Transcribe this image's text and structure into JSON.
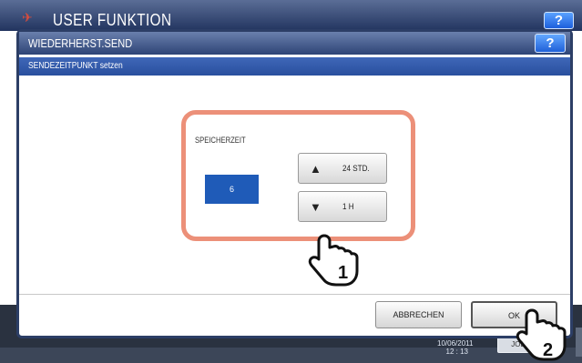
{
  "background": {
    "title": "USER FUNKTION",
    "help_label": "?",
    "clock_date": "10/06/2011",
    "clock_time": "12 : 13",
    "job_label": "JOB"
  },
  "dialog": {
    "title": "WIEDERHERST.SEND",
    "help_label": "?",
    "subtitle": "SENDEZEITPUNKT setzen",
    "field_label": "SPEICHERZEIT",
    "value": "6",
    "up_button": {
      "icon": "up-arrow-icon",
      "label": "24 STD."
    },
    "down_button": {
      "icon": "down-arrow-icon",
      "label": "1 H"
    },
    "cancel_label": "ABBRECHEN",
    "ok_label": "OK"
  },
  "annotations": {
    "step1": "1",
    "step2": "2"
  },
  "colors": {
    "header": "#2e4476",
    "subheader": "#294f9e",
    "value_box": "#1f5bb8",
    "highlight": "#ec9079"
  }
}
